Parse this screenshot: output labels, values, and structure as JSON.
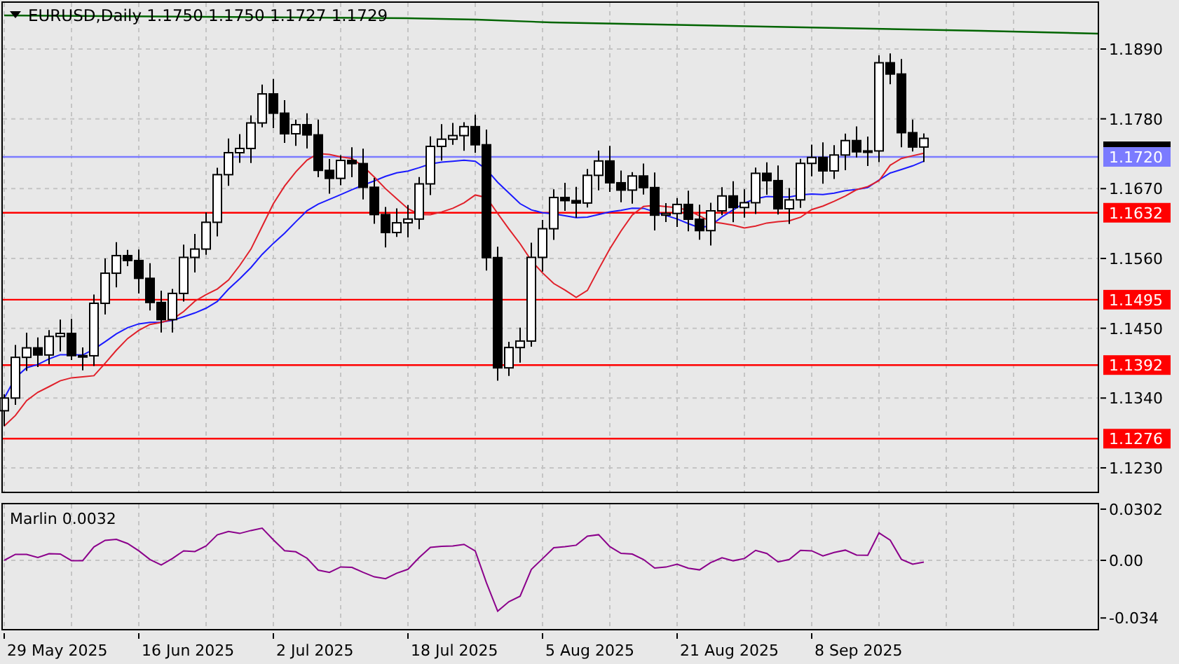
{
  "chart": {
    "symbol": "EURUSD,Daily",
    "ohlc": [
      "1.1750",
      "1.1750",
      "1.1727",
      "1.1729"
    ],
    "price_axis": [
      "1.1890",
      "1.1780",
      "1.1670",
      "1.1560",
      "1.1450",
      "1.1340",
      "1.1230"
    ],
    "horizontal_lines": [
      {
        "label": "1.1720",
        "color": "#7b7bff"
      },
      {
        "label": "1.1632",
        "color": "#ff0000"
      },
      {
        "label": "1.1495",
        "color": "#ff0000"
      },
      {
        "label": "1.1392",
        "color": "#ff0000"
      },
      {
        "label": "1.1276",
        "color": "#ff0000"
      }
    ]
  },
  "indicator": {
    "title": "Marlin 0.0032",
    "axis": [
      "0.0302",
      "0.00",
      "-0.034"
    ]
  },
  "time_axis": [
    "29 May 2025",
    "16 Jun 2025",
    "2 Jul 2025",
    "18 Jul 2025",
    "5 Aug 2025",
    "21 Aug 2025",
    "8 Sep 2025"
  ]
}
